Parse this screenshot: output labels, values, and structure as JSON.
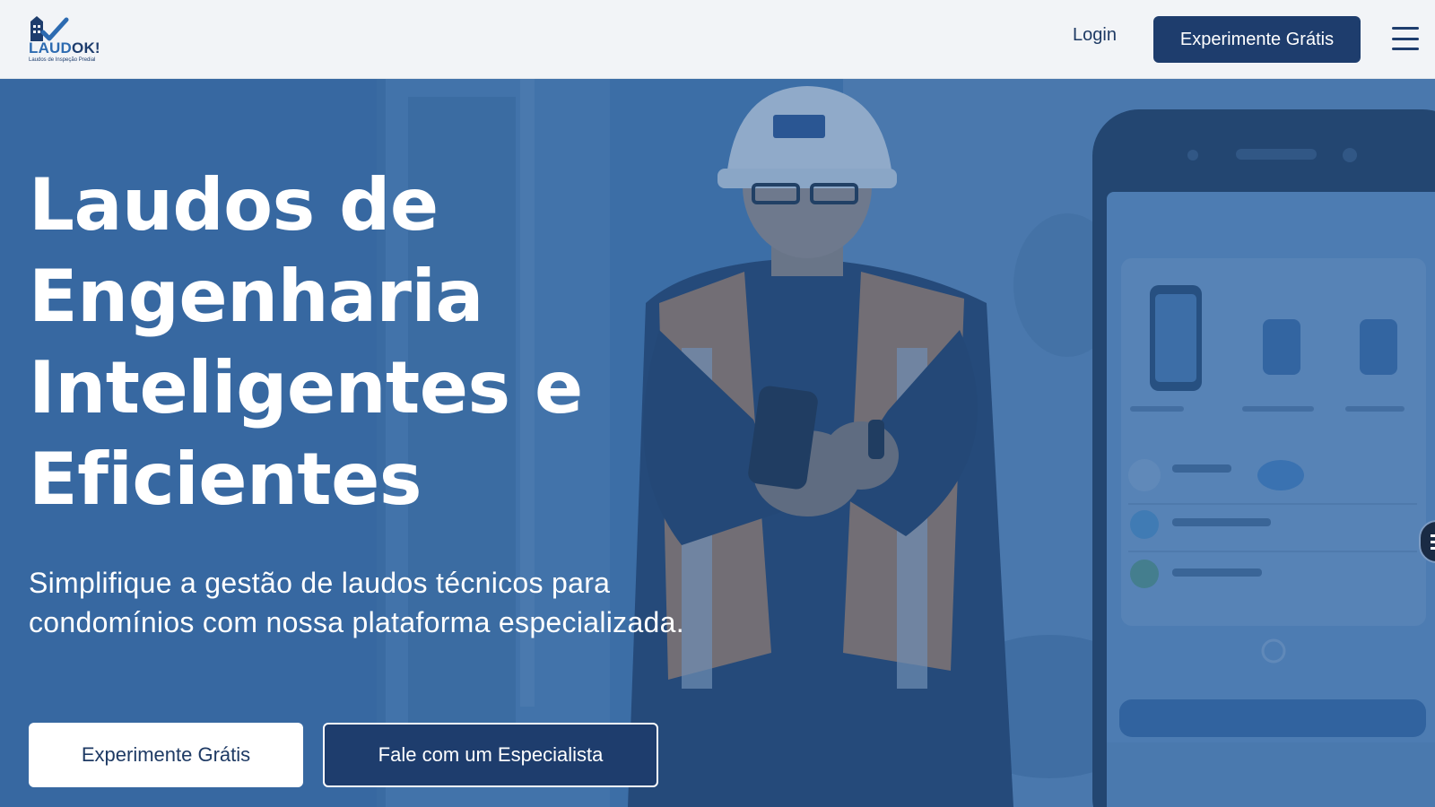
{
  "brand": {
    "name_part1": "LAUD",
    "name_part2": "OK!",
    "tagline": "Laudos de Inspeção Predial"
  },
  "nav": {
    "login_label": "Login",
    "cta_label": "Experimente Grátis",
    "menu_icon": "hamburger-icon"
  },
  "hero": {
    "headline_lines": [
      "Laudos de",
      "Engenharia",
      "Inteligentes e",
      "Eficientes"
    ],
    "subtitle": "Simplifique a gestão de laudos técnicos para condomínios com nossa plataforma especializada.",
    "primary_button": "Experimente Grátis",
    "secondary_button": "Fale com um Especialista"
  },
  "colors": {
    "brand_navy": "#1e3d6d",
    "overlay_blue": "#4b7db2",
    "white": "#ffffff"
  }
}
